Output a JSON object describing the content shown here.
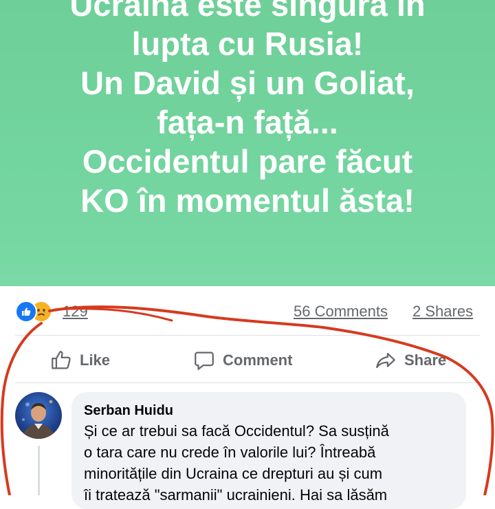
{
  "post": {
    "banner_lines": [
      "Ucraina este singură în",
      "lupta cu Rusia!",
      "Un David și un Goliat,",
      "fața-n față...",
      "Occidentul pare făcut",
      "KO în momentul ăsta!"
    ],
    "banner_color": "#72d49e"
  },
  "stats": {
    "reaction_icons": [
      "like-icon",
      "sad-emoji-icon"
    ],
    "reaction_count": "129",
    "comments": "56 Comments",
    "shares": "2 Shares"
  },
  "actions": {
    "like": "Like",
    "comment": "Comment",
    "share": "Share"
  },
  "comment": {
    "author": "Serban Huidu",
    "lines": [
      "Și ce ar trebui sa facă Occidentul? Sa susțină",
      "o tara care nu crede în valorile lui? Întreabă",
      "minoritățile din Ucraina ce drepturi au și cum",
      "îi tratează \"sarmanii\" ucrainieni. Hai sa lăsăm"
    ]
  },
  "colors": {
    "accent_blue": "#1877f2",
    "annotation_red": "#d63a1e"
  }
}
